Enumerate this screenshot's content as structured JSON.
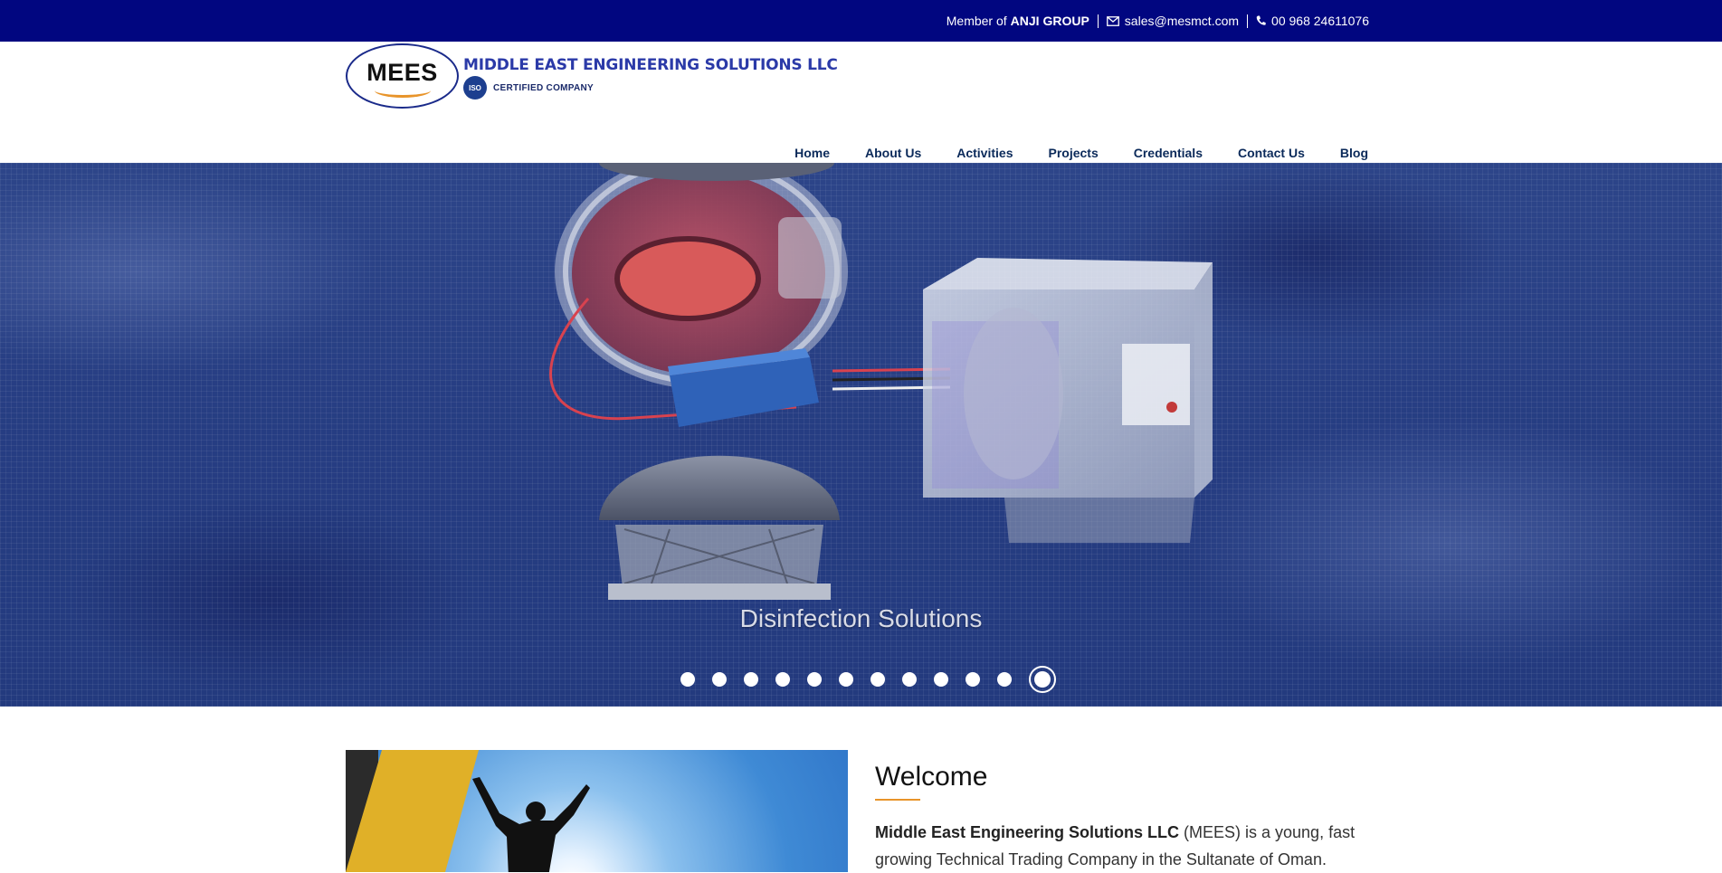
{
  "topbar": {
    "member_prefix": "Member of",
    "member_group": "ANJI GROUP",
    "email": "sales@mesmct.com",
    "phone": "00 968 24611076"
  },
  "logo": {
    "mark": "MEES",
    "company_name": "MIDDLE EAST ENGINEERING SOLUTIONS LLC",
    "iso_badge": "ISO",
    "certified": "CERTIFIED COMPANY"
  },
  "nav": {
    "items": [
      "Home",
      "About Us",
      "Activities",
      "Projects",
      "Credentials",
      "Contact Us",
      "Blog"
    ]
  },
  "hero": {
    "caption": "Disinfection Solutions",
    "slide_count": 12,
    "active_slide": 12
  },
  "welcome": {
    "heading": "Welcome",
    "company_bold": "Middle East Engineering Solutions LLC",
    "body_rest": " (MEES) is a young, fast growing Technical Trading Company in the Sultanate of Oman."
  },
  "colors": {
    "topbar": "#010680",
    "accent": "#e8942a",
    "nav_text": "#0b2a5a",
    "hero_blue": "#263d82"
  },
  "icons": [
    "envelope-icon",
    "phone-icon",
    "iso-badge-icon"
  ]
}
